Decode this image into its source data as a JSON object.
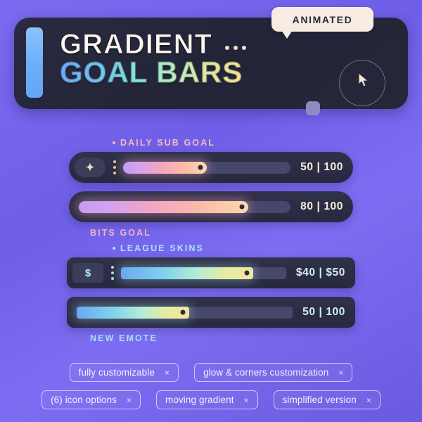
{
  "header": {
    "badge_label": "ANIMATED",
    "title_main": "GRADIENT",
    "title_sub": "GOAL BARS",
    "cursor_icon": "arrow-cursor-icon",
    "accent_color": "#6aaef9",
    "card_color": "#25263a"
  },
  "goal_bars": [
    {
      "label": "DAILY SUB GOAL",
      "label_position": "above",
      "label_color": "#f7b7bd",
      "has_bullet": true,
      "icon": "sparkle-icon",
      "icon_glyph": "✦",
      "show_icon": true,
      "show_dots": true,
      "value_text": "50 | 100",
      "current": 50,
      "max": 100,
      "percent": 50,
      "corner_style": "round",
      "gradient": [
        "#c49bf5",
        "#f5a6c0",
        "#fbd9ae"
      ],
      "value_color": "#f9ecd9"
    },
    {
      "label": "BITS GOAL",
      "label_position": "below",
      "label_color": "#f7b7bd",
      "has_bullet": false,
      "icon": "none",
      "icon_glyph": "",
      "show_icon": false,
      "show_dots": false,
      "value_text": "80 | 100",
      "current": 80,
      "max": 100,
      "percent": 80,
      "corner_style": "round",
      "gradient": [
        "#c49bf5",
        "#f5a6c0",
        "#fbd9ae"
      ],
      "value_color": "#f9ecd9"
    },
    {
      "label": "LEAGUE SKINS",
      "label_position": "above",
      "label_color": "#a9e2f3",
      "has_bullet": true,
      "icon": "dollar-icon",
      "icon_glyph": "$",
      "show_icon": true,
      "show_dots": true,
      "value_text": "$40 | $50",
      "current": 40,
      "max": 50,
      "percent": 80,
      "corner_style": "sharp",
      "gradient": [
        "#6aa8f2",
        "#b5ecd4",
        "#f7e49a"
      ],
      "value_color": "#cfeff8"
    },
    {
      "label": "NEW EMOTE",
      "label_position": "below",
      "label_color": "#a9e2f3",
      "has_bullet": false,
      "icon": "none",
      "icon_glyph": "",
      "show_icon": false,
      "show_dots": false,
      "value_text": "50 | 100",
      "current": 50,
      "max": 100,
      "percent": 52,
      "corner_style": "sharp",
      "gradient": [
        "#6aa8f2",
        "#b5ecd4",
        "#f7e49a"
      ],
      "value_color": "#cfeff8"
    }
  ],
  "tags": {
    "row1": [
      {
        "label": "fully customizable",
        "close": "×"
      },
      {
        "label": "glow & corners customization",
        "close": "×"
      }
    ],
    "row2": [
      {
        "label": "(6) icon options",
        "close": "×"
      },
      {
        "label": "moving gradient",
        "close": "×"
      },
      {
        "label": "simplified version",
        "close": "×"
      }
    ]
  }
}
